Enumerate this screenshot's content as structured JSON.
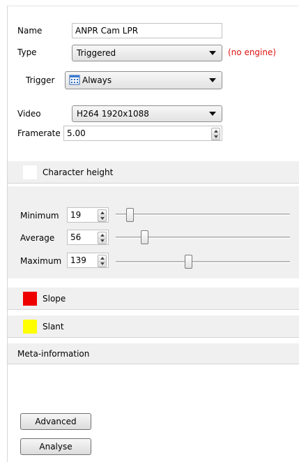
{
  "name": {
    "label": "Name",
    "value": "ANPR Cam LPR"
  },
  "type": {
    "label": "Type",
    "value": "Triggered",
    "warning": "(no engine)",
    "warning_color": "#e01010"
  },
  "trigger": {
    "label": "Trigger",
    "value": "Always",
    "icon": "calendar-icon"
  },
  "video": {
    "label": "Video",
    "value": "H264 1920x1088"
  },
  "framerate": {
    "label": "Framerate",
    "value": "5.00"
  },
  "character_height": {
    "title": "Character height",
    "minimum": {
      "label": "Minimum",
      "value": "19"
    },
    "average": {
      "label": "Average",
      "value": "56"
    },
    "maximum": {
      "label": "Maximum",
      "value": "139"
    }
  },
  "slope": {
    "title": "Slope",
    "color": "#ee0000"
  },
  "slant": {
    "title": "Slant",
    "color": "#ffff00"
  },
  "meta": {
    "title": "Meta-information"
  },
  "buttons": {
    "advanced": "Advanced",
    "analyse": "Analyse"
  }
}
